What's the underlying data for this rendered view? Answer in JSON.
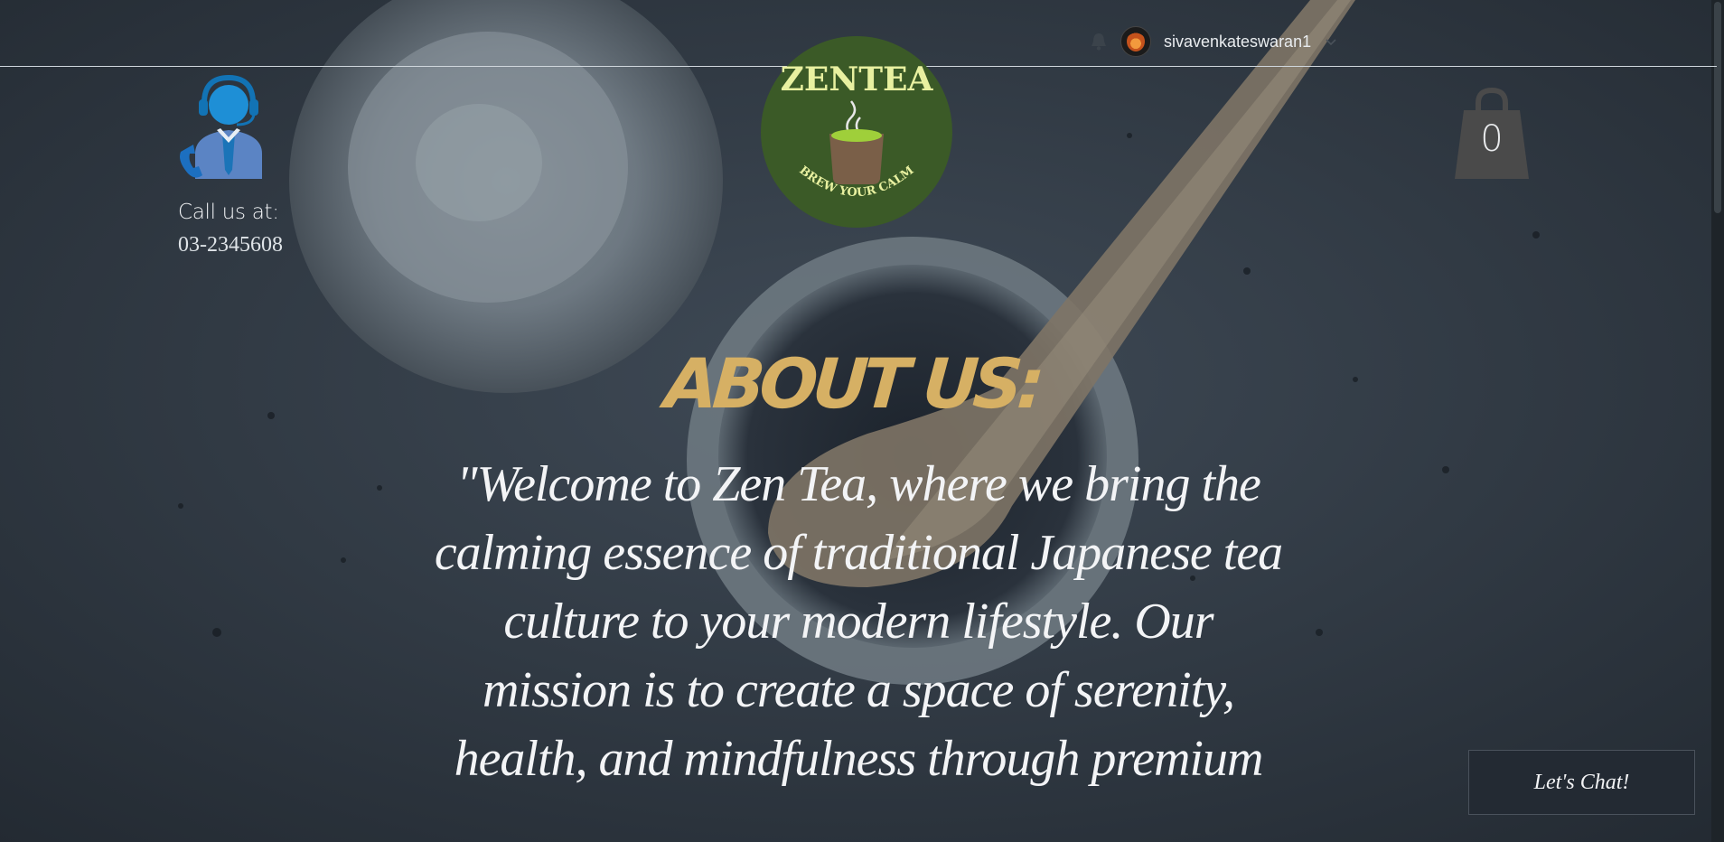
{
  "header": {
    "username": "sivavenkateswaran1",
    "icons": {
      "notifications": "bell-icon",
      "account_menu": "chevron-down-icon",
      "support": "customer-support-icon"
    }
  },
  "contact": {
    "label": "Call us at:",
    "phone": "03-2345608"
  },
  "logo": {
    "brand": "ZENTEA",
    "tagline": "BREW YOUR CALM"
  },
  "cart": {
    "count": "0",
    "icon": "shopping-bag-icon"
  },
  "about": {
    "title": "ABOUT US:",
    "text": "\"Welcome to Zen Tea, where we bring the calming essence of traditional Japanese tea culture to your modern lifestyle. Our mission is to create a space of serenity, health, and mindfulness through premium"
  },
  "chat": {
    "label": "Let's Chat!"
  },
  "colors": {
    "accent_gold": "#d6b064",
    "logo_green": "#3b5a27",
    "logo_text": "#e8f0a0",
    "background": "#2c3540"
  }
}
